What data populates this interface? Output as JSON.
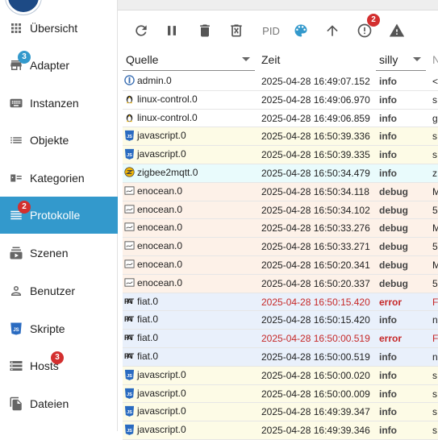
{
  "sidebar": {
    "items": [
      {
        "key": "uebersicht",
        "label": "Übersicht",
        "icon": "grid-icon",
        "badge": null,
        "active": false
      },
      {
        "key": "adapter",
        "label": "Adapter",
        "icon": "store-icon",
        "badge": "3",
        "badge_color": "#3399cc",
        "active": false
      },
      {
        "key": "instanzen",
        "label": "Instanzen",
        "icon": "keyboard-icon",
        "badge": null,
        "active": false
      },
      {
        "key": "objekte",
        "label": "Objekte",
        "icon": "list-icon",
        "badge": null,
        "active": false
      },
      {
        "key": "kategorien",
        "label": "Kategorien",
        "icon": "category-icon",
        "badge": null,
        "active": false
      },
      {
        "key": "protokolle",
        "label": "Protokolle",
        "icon": "log-lines-icon",
        "badge": "2",
        "badge_color": "#d32f2f",
        "active": true
      },
      {
        "key": "szenen",
        "label": "Szenen",
        "icon": "subscriptions-icon",
        "badge": null,
        "active": false
      },
      {
        "key": "benutzer",
        "label": "Benutzer",
        "icon": "person-icon",
        "badge": null,
        "active": false
      },
      {
        "key": "skripte",
        "label": "Skripte",
        "icon": "javascript-icon",
        "badge": null,
        "active": false
      },
      {
        "key": "hosts",
        "label": "Hosts",
        "icon": "storage-icon",
        "badge": "3",
        "badge_color": "#d32f2f",
        "active": false
      },
      {
        "key": "dateien",
        "label": "Dateien",
        "icon": "files-icon",
        "badge": null,
        "active": false
      }
    ]
  },
  "toolbar": {
    "pid_label": "PID",
    "warning_badge": "2"
  },
  "table": {
    "headers": {
      "source": "Quelle",
      "time": "Zeit",
      "severity": "silly",
      "message": "N"
    },
    "rows": [
      {
        "source": "admin.0",
        "icon": "admin",
        "time": "2025-04-28 16:49:07.152",
        "severity": "info",
        "msg": "<",
        "bg": "#ffffff"
      },
      {
        "source": "linux-control.0",
        "icon": "tux",
        "time": "2025-04-28 16:49:06.970",
        "severity": "info",
        "msg": "s",
        "bg": "#ffffff"
      },
      {
        "source": "linux-control.0",
        "icon": "tux",
        "time": "2025-04-28 16:49:06.859",
        "severity": "info",
        "msg": "g",
        "bg": "#ffffff"
      },
      {
        "source": "javascript.0",
        "icon": "js",
        "time": "2025-04-28 16:50:39.336",
        "severity": "info",
        "msg": "s",
        "bg": "#fdfbe6"
      },
      {
        "source": "javascript.0",
        "icon": "js",
        "time": "2025-04-28 16:50:39.335",
        "severity": "info",
        "msg": "s",
        "bg": "#fdfbe6"
      },
      {
        "source": "zigbee2mqtt.0",
        "icon": "zigbee",
        "time": "2025-04-28 16:50:34.479",
        "severity": "info",
        "msg": "z",
        "bg": "#e9fbfc"
      },
      {
        "source": "enocean.0",
        "icon": "enocean",
        "time": "2025-04-28 16:50:34.118",
        "severity": "debug",
        "msg": "M",
        "bg": "#fdf1e8"
      },
      {
        "source": "enocean.0",
        "icon": "enocean",
        "time": "2025-04-28 16:50:34.102",
        "severity": "debug",
        "msg": "5",
        "bg": "#fdf1e8"
      },
      {
        "source": "enocean.0",
        "icon": "enocean",
        "time": "2025-04-28 16:50:33.276",
        "severity": "debug",
        "msg": "M",
        "bg": "#fdf1e8"
      },
      {
        "source": "enocean.0",
        "icon": "enocean",
        "time": "2025-04-28 16:50:33.271",
        "severity": "debug",
        "msg": "5",
        "bg": "#fdf1e8"
      },
      {
        "source": "enocean.0",
        "icon": "enocean",
        "time": "2025-04-28 16:50:20.341",
        "severity": "debug",
        "msg": "M",
        "bg": "#fdf1e8"
      },
      {
        "source": "enocean.0",
        "icon": "enocean",
        "time": "2025-04-28 16:50:20.337",
        "severity": "debug",
        "msg": "5",
        "bg": "#fdf1e8"
      },
      {
        "source": "fiat.0",
        "icon": "fiat",
        "time": "2025-04-28 16:50:15.420",
        "severity": "error",
        "msg": "F",
        "bg": "#e9f0fb"
      },
      {
        "source": "fiat.0",
        "icon": "fiat",
        "time": "2025-04-28 16:50:15.420",
        "severity": "info",
        "msg": "n",
        "bg": "#e9f0fb"
      },
      {
        "source": "fiat.0",
        "icon": "fiat",
        "time": "2025-04-28 16:50:00.519",
        "severity": "error",
        "msg": "F",
        "bg": "#e9f0fb"
      },
      {
        "source": "fiat.0",
        "icon": "fiat",
        "time": "2025-04-28 16:50:00.519",
        "severity": "info",
        "msg": "n",
        "bg": "#e9f0fb"
      },
      {
        "source": "javascript.0",
        "icon": "js",
        "time": "2025-04-28 16:50:00.020",
        "severity": "info",
        "msg": "s",
        "bg": "#fdfbe6"
      },
      {
        "source": "javascript.0",
        "icon": "js",
        "time": "2025-04-28 16:50:00.009",
        "severity": "info",
        "msg": "s",
        "bg": "#fdfbe6"
      },
      {
        "source": "javascript.0",
        "icon": "js",
        "time": "2025-04-28 16:49:39.347",
        "severity": "info",
        "msg": "s",
        "bg": "#fdfbe6"
      },
      {
        "source": "javascript.0",
        "icon": "js",
        "time": "2025-04-28 16:49:39.346",
        "severity": "info",
        "msg": "s",
        "bg": "#fdfbe6"
      }
    ]
  },
  "colors": {
    "accent": "#3399cc",
    "error_text": "#c62828",
    "badge_red": "#d32f2f"
  }
}
